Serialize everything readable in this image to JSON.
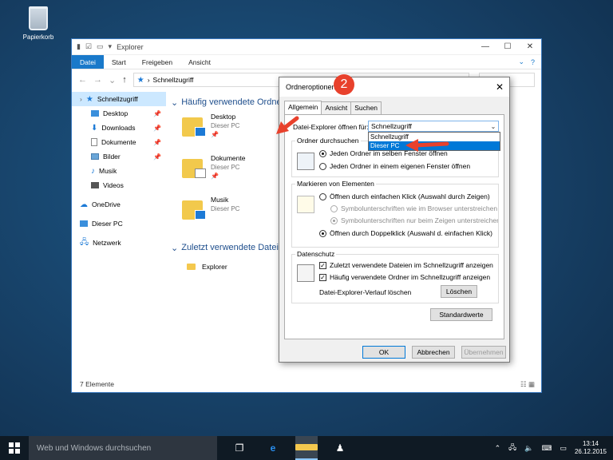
{
  "desktop": {
    "recycle_label": "Papierkorb"
  },
  "explorer": {
    "title": "Explorer",
    "ribbon": [
      "Datei",
      "Start",
      "Freigeben",
      "Ansicht"
    ],
    "address": "Schnellzugriff",
    "sidebar": {
      "quick": "Schnellzugriff",
      "items": [
        "Desktop",
        "Downloads",
        "Dokumente",
        "Bilder",
        "Musik",
        "Videos"
      ],
      "onedrive": "OneDrive",
      "thispc": "Dieser PC",
      "network": "Netzwerk"
    },
    "frequent_header": "Häufig verwendete Ordner",
    "folders": [
      {
        "name": "Desktop",
        "loc": "Dieser PC"
      },
      {
        "name": "Dokumente",
        "loc": "Dieser PC"
      },
      {
        "name": "Musik",
        "loc": "Dieser PC"
      }
    ],
    "recent_header": "Zuletzt verwendete Dateien",
    "recent_item": "Explorer",
    "status": "7 Elemente"
  },
  "dialog": {
    "title": "Ordneroptionen",
    "tabs": [
      "Allgemein",
      "Ansicht",
      "Suchen"
    ],
    "open_label": "Datei-Explorer öffnen für:",
    "select_value": "Schnellzugriff",
    "dropdown": [
      "Schnellzugriff",
      "Dieser PC"
    ],
    "browse_group": "Ordner durchsuchen",
    "browse_opt1": "Jeden Ordner im selben Fenster öffnen",
    "browse_opt2": "Jeden Ordner in einem eigenen Fenster öffnen",
    "click_group": "Markieren von Elementen",
    "click_opt1": "Öffnen durch einfachen Klick (Auswahl durch Zeigen)",
    "click_sub1": "Symbolunterschriften wie im Browser unterstreichen",
    "click_sub2": "Symbolunterschriften nur beim Zeigen unterstreichen",
    "click_opt2": "Öffnen durch Doppelklick (Auswahl d. einfachen Klick)",
    "privacy_group": "Datenschutz",
    "privacy_chk1": "Zuletzt verwendete Dateien im Schnellzugriff anzeigen",
    "privacy_chk2": "Häufig verwendete Ordner im Schnellzugriff anzeigen",
    "clear_label": "Datei-Explorer-Verlauf löschen",
    "clear_btn": "Löschen",
    "defaults_btn": "Standardwerte",
    "ok": "OK",
    "cancel": "Abbrechen",
    "apply": "Übernehmen"
  },
  "annotation": {
    "step": "2"
  },
  "taskbar": {
    "search_placeholder": "Web und Windows durchsuchen",
    "time": "13:14",
    "date": "26.12.2015"
  },
  "colors": {
    "accent": "#1979ca",
    "annotation": "#e8412c"
  }
}
